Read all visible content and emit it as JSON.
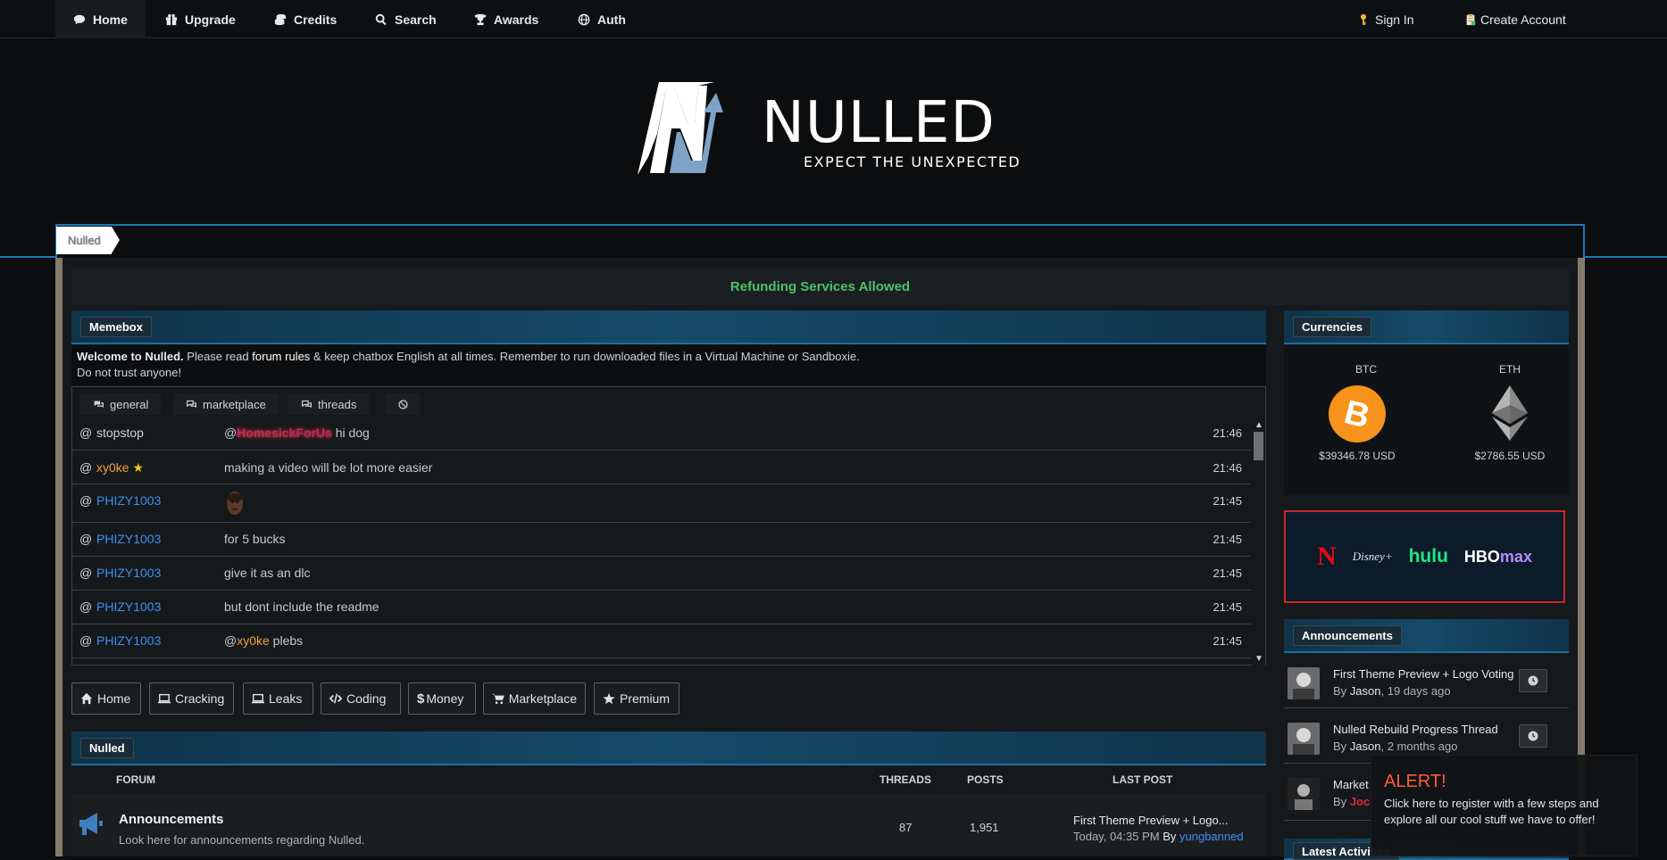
{
  "nav": {
    "items": [
      {
        "label": "Home",
        "icon": "comment-icon"
      },
      {
        "label": "Upgrade",
        "icon": "gift-icon"
      },
      {
        "label": "Credits",
        "icon": "coins-icon"
      },
      {
        "label": "Search",
        "icon": "search-icon"
      },
      {
        "label": "Awards",
        "icon": "trophy-icon"
      },
      {
        "label": "Auth",
        "icon": "globe-icon"
      }
    ],
    "sign_in": "Sign In",
    "create_account": "Create Account"
  },
  "logo": {
    "title": "NULLED",
    "tagline": "EXPECT THE UNEXPECTED"
  },
  "breadcrumb": "Nulled",
  "notice": "Refunding Services Allowed",
  "memebox": {
    "header": "Memebox",
    "welcome_bold": "Welcome to Nulled.",
    "welcome_pre": " Please read ",
    "welcome_link": "forum rules",
    "welcome_post": " & keep chatbox English at all times. Remember to run downloaded files in a Virtual Machine or Sandboxie.",
    "welcome_line2": "Do not trust anyone!",
    "tabs": [
      "general",
      "marketplace",
      "threads"
    ],
    "messages": [
      {
        "user": "stopstop",
        "mention": "@",
        "mention_user": "HomesickForUs",
        "text": " hi dog",
        "time": "21:46"
      },
      {
        "user": "xy0ke",
        "text": "making a video will be lot more easier",
        "time": "21:46"
      },
      {
        "user": "PHIZY1003",
        "text": "",
        "time": "21:45"
      },
      {
        "user": "PHIZY1003",
        "text": "for 5 bucks",
        "time": "21:45"
      },
      {
        "user": "PHIZY1003",
        "text": "give it as an dlc",
        "time": "21:45"
      },
      {
        "user": "PHIZY1003",
        "text": "but dont include the readme",
        "time": "21:45"
      },
      {
        "user": "PHIZY1003",
        "mention": "@",
        "mention_user": "xy0ke",
        "text": " plebs",
        "time": "21:45"
      }
    ]
  },
  "categories": [
    "Home",
    "Cracking",
    "Leaks",
    "Coding",
    "Money",
    "Marketplace",
    "Premium"
  ],
  "forum": {
    "header": "Nulled",
    "columns": {
      "forum": "FORUM",
      "threads": "THREADS",
      "posts": "POSTS",
      "last_post": "LAST POST"
    },
    "rows": [
      {
        "name": "Announcements",
        "description": "Look here for announcements regarding Nulled.",
        "threads": "87",
        "posts": "1,951",
        "last_title": "First Theme Preview + Logo...",
        "last_time": "Today, 04:35 PM",
        "last_by": "By",
        "last_user": "yungbanned"
      }
    ]
  },
  "currencies": {
    "header": "Currencies",
    "btc_label": "BTC",
    "btc_price": "$39346.78 USD",
    "eth_label": "ETH",
    "eth_price": "$2786.55 USD"
  },
  "ad": {
    "n": "N",
    "disney": "Disney+",
    "hulu": "hulu",
    "hbo": "HBO",
    "max": "max"
  },
  "announcements": {
    "header": "Announcements",
    "items": [
      {
        "title": "First Theme Preview + Logo Voting",
        "by": "By ",
        "user": "Jason",
        "ago": ", 19 days ago"
      },
      {
        "title": "Nulled Rebuild Progress Thread",
        "by": "By ",
        "user": "Jason",
        "ago": ", 2 months ago"
      },
      {
        "title": "Market",
        "by": "By ",
        "user": "Joc",
        "ago": ""
      }
    ]
  },
  "latest": {
    "header": "Latest Activities"
  },
  "alert": {
    "title": "ALERT!",
    "text": "Click here to register with a few steps and explore all our cool stuff we have to offer!"
  },
  "colors": {
    "accent": "#1c78b8",
    "notice": "#4cc36a",
    "alert": "#ff5a3c",
    "user_blue": "#3d8ff0",
    "user_orange": "#f0a03c"
  }
}
